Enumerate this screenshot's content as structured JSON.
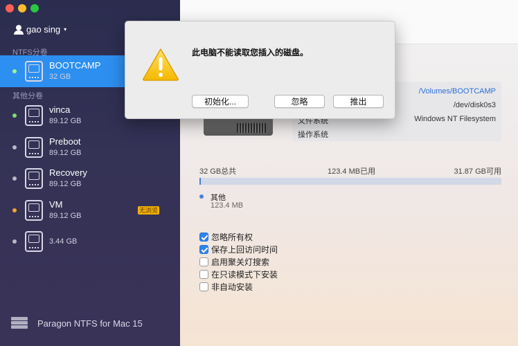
{
  "window": {
    "controls": [
      "close",
      "minimize",
      "zoom"
    ]
  },
  "sidebar": {
    "user": "gao sing",
    "ntfs_section_label": "NTFS分卷",
    "other_section_label": "其他分卷",
    "volumes": [
      {
        "name": "BOOTCAMP",
        "size": "32 GB",
        "selected": true,
        "status_color": "#9cf58a"
      },
      {
        "name": "vinca",
        "size": "89.12 GB",
        "status_color": "#7ee06a"
      },
      {
        "name": "Preboot",
        "size": "89.12 GB",
        "status_color": "#b8b8c8"
      },
      {
        "name": "Recovery",
        "size": "89.12 GB",
        "status_color": "#b8b8c8"
      },
      {
        "name": "VM",
        "size": "89.12 GB",
        "status_color": "#f5a623",
        "badge": "无浏览"
      },
      {
        "name": "",
        "size": "3.44 GB",
        "status_color": "#b8b8c8"
      }
    ],
    "footer": "Paragon NTFS for Mac 15"
  },
  "main": {
    "info": {
      "mount_path": "/Volumes/BOOTCAMP",
      "device": "/dev/disk0s3",
      "fs_label": "文件系统",
      "fs_value": "Windows NT Filesystem",
      "os_label": "操作系统"
    },
    "usage": {
      "total": "32 GB总共",
      "used": "123.4 MB已用",
      "free": "31.87 GB可用",
      "used_fraction": 0.004
    },
    "legend": {
      "name": "其他",
      "size": "123.4 MB"
    },
    "options": [
      {
        "label": "忽略所有权",
        "checked": true
      },
      {
        "label": "保存上回访问时间",
        "checked": true
      },
      {
        "label": "启用聚关灯搜索",
        "checked": false
      },
      {
        "label": "在只读模式下安装",
        "checked": false
      },
      {
        "label": "非自动安装",
        "checked": false
      }
    ]
  },
  "dialog": {
    "message": "此电脑不能读取您插入的磁盘。",
    "buttons": {
      "initialize": "初始化...",
      "ignore": "忽略",
      "eject": "推出"
    },
    "icon": "warning-icon"
  }
}
